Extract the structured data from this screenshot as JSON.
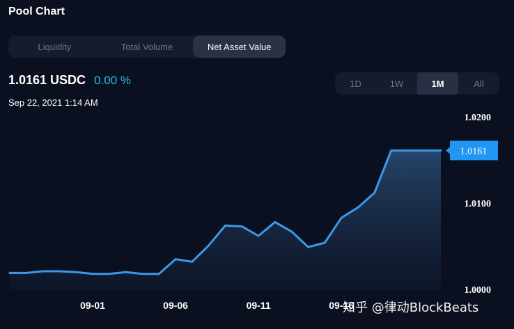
{
  "header": {
    "title": "Pool Chart"
  },
  "tabs": [
    {
      "label": "Liquidity"
    },
    {
      "label": "Total Volume"
    },
    {
      "label": "Net Asset Value"
    }
  ],
  "active_tab": 2,
  "price": {
    "value": "1.0161 USDC",
    "change": "0.00 %"
  },
  "timestamp": "Sep 22, 2021 1:14 AM",
  "ranges": [
    {
      "label": "1D"
    },
    {
      "label": "1W"
    },
    {
      "label": "1M"
    },
    {
      "label": "All"
    }
  ],
  "active_range": 2,
  "watermark": "知乎 @律动BlockBeats",
  "colors": {
    "background": "#0a1020",
    "line": "#3a9ae8",
    "accent": "#23c2e0",
    "label_bg": "#2196f3"
  },
  "chart_data": {
    "type": "area",
    "x_ticks": [
      "09-01",
      "09-06",
      "09-11",
      "09-16"
    ],
    "y_ticks": [
      "1.0200",
      "1.0100",
      "1.0000"
    ],
    "ylim": [
      1.0,
      1.02
    ],
    "current_label": "1.0161",
    "current_value": 1.0161,
    "x": [
      "08-27",
      "08-28",
      "08-29",
      "08-30",
      "08-31",
      "09-01",
      "09-02",
      "09-03",
      "09-04",
      "09-05",
      "09-06",
      "09-07",
      "09-08",
      "09-09",
      "09-10",
      "09-11",
      "09-12",
      "09-13",
      "09-14",
      "09-15",
      "09-16",
      "09-17",
      "09-18",
      "09-19",
      "09-20",
      "09-21",
      "09-22"
    ],
    "values": [
      1.0019,
      1.0019,
      1.0021,
      1.0021,
      1.002,
      1.0018,
      1.0018,
      1.002,
      1.0018,
      1.0018,
      1.0035,
      1.0032,
      1.0051,
      1.0074,
      1.0073,
      1.0062,
      1.0078,
      1.0067,
      1.0049,
      1.0054,
      1.0083,
      1.0095,
      1.0112,
      1.0161,
      1.0161,
      1.0161,
      1.0161
    ]
  }
}
